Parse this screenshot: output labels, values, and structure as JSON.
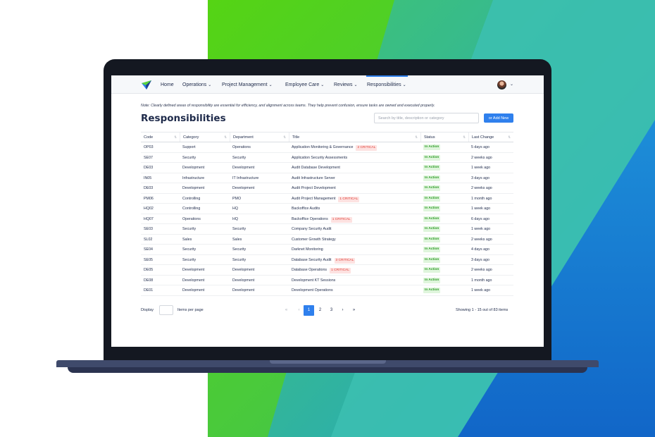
{
  "nav": {
    "items": [
      {
        "label": "Home",
        "has_menu": false
      },
      {
        "label": "Operations",
        "has_menu": true
      },
      {
        "label": "Project Management",
        "has_menu": true
      },
      {
        "label": "Employee Care",
        "has_menu": true
      },
      {
        "label": "Reviews",
        "has_menu": true
      },
      {
        "label": "Responsibilities",
        "has_menu": true
      }
    ],
    "active": "Responsibilities",
    "chevron": "⌄"
  },
  "note": "Note: Clearly defined areas of responsibility are essential for efficiency, and alignment across teams. They help prevent confusion, ensure tasks are owned and executed properly.",
  "page": {
    "title": "Responsibilities",
    "search_placeholder": "Search by title, description or category",
    "add_button": "or Add New"
  },
  "table": {
    "columns": [
      "Code",
      "Category",
      "Department",
      "Title",
      "Status",
      "Last Change"
    ],
    "rows": [
      {
        "code": "OP03",
        "category": "Support",
        "department": "Operations",
        "title": "Application Monitoring & Governance",
        "critical": "2 CRITICAL",
        "status": "In Action",
        "last_change": "5 days ago"
      },
      {
        "code": "SE07",
        "category": "Security",
        "department": "Security",
        "title": "Application Security Assessments",
        "critical": "",
        "status": "In Action",
        "last_change": "2 weeks ago"
      },
      {
        "code": "DE03",
        "category": "Development",
        "department": "Development",
        "title": "Audit Database Development",
        "critical": "",
        "status": "In Action",
        "last_change": "1 week ago"
      },
      {
        "code": "IN05",
        "category": "Infrastructure",
        "department": "IT Infrastructure",
        "title": "Audit Infrastructure Server",
        "critical": "",
        "status": "In Action",
        "last_change": "3 days ago"
      },
      {
        "code": "DE03",
        "category": "Development",
        "department": "Development",
        "title": "Audit Project Development",
        "critical": "",
        "status": "In Action",
        "last_change": "2 weeks ago"
      },
      {
        "code": "PM06",
        "category": "Controlling",
        "department": "PMO",
        "title": "Audit Project Management",
        "critical": "1 CRITICAL",
        "status": "In Action",
        "last_change": "1 month ago"
      },
      {
        "code": "HQ02",
        "category": "Controlling",
        "department": "HQ",
        "title": "Backoffice Audits",
        "critical": "",
        "status": "In Action",
        "last_change": "1 week ago"
      },
      {
        "code": "HQ07",
        "category": "Operations",
        "department": "HQ",
        "title": "Backoffice Operations",
        "critical": "1 CRITICAL",
        "status": "In Action",
        "last_change": "6 days ago"
      },
      {
        "code": "SE03",
        "category": "Security",
        "department": "Security",
        "title": "Company Security Audit",
        "critical": "",
        "status": "In Action",
        "last_change": "1 week ago"
      },
      {
        "code": "SL02",
        "category": "Sales",
        "department": "Sales",
        "title": "Customer Growth Strategy",
        "critical": "",
        "status": "In Action",
        "last_change": "2 weeks ago"
      },
      {
        "code": "SE04",
        "category": "Security",
        "department": "Security",
        "title": "Darknet Monitoring",
        "critical": "",
        "status": "In Action",
        "last_change": "4 days ago"
      },
      {
        "code": "SE05",
        "category": "Security",
        "department": "Security",
        "title": "Database Security Audit",
        "critical": "3 CRITICAL",
        "status": "In Action",
        "last_change": "3 days ago"
      },
      {
        "code": "DE05",
        "category": "Development",
        "department": "Development",
        "title": "Database Operations",
        "critical": "1 CRITICAL",
        "status": "In Action",
        "last_change": "2 weeks ago"
      },
      {
        "code": "DE08",
        "category": "Development",
        "department": "Development",
        "title": "Development KT Sessions",
        "critical": "",
        "status": "In Action",
        "last_change": "1 month ago"
      },
      {
        "code": "DE01",
        "category": "Development",
        "department": "Development",
        "title": "Development Operations",
        "critical": "",
        "status": "In Action",
        "last_change": "1 week ago"
      }
    ]
  },
  "footer": {
    "display_label": "Display",
    "per_page_label": "Items per page",
    "pagination": [
      "«",
      "‹",
      "1",
      "2",
      "3",
      "›",
      "»"
    ],
    "current_page": "1",
    "showing": "Showing 1 - 15 out of 83 items"
  },
  "colors": {
    "accent": "#2f80ed",
    "critical_bg": "#fde2e1",
    "critical_fg": "#e0423a",
    "status_bg": "#dff5dc",
    "status_fg": "#2e9b27"
  }
}
